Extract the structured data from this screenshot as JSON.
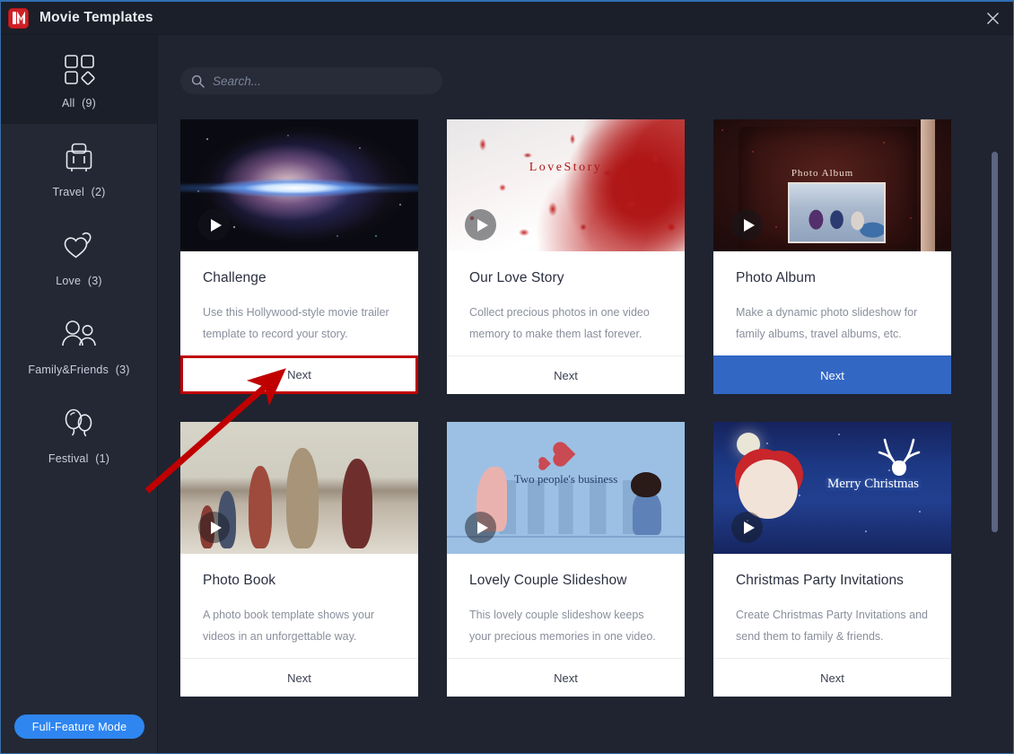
{
  "window": {
    "title": "Movie Templates",
    "close_icon": "close-icon",
    "app_icon": "app-logo-icon"
  },
  "sidebar": {
    "items": [
      {
        "label": "All",
        "count": "(9)",
        "icon": "grid-icon",
        "active": true
      },
      {
        "label": "Travel",
        "count": "(2)",
        "icon": "suitcase-icon",
        "active": false
      },
      {
        "label": "Love",
        "count": "(3)",
        "icon": "hearts-icon",
        "active": false
      },
      {
        "label": "Family&Friends",
        "count": "(3)",
        "icon": "people-icon",
        "active": false
      },
      {
        "label": "Festival",
        "count": "(1)",
        "icon": "balloons-icon",
        "active": false
      }
    ],
    "full_feature_button": "Full-Feature Mode"
  },
  "search": {
    "placeholder": "Search...",
    "value": "",
    "icon": "search-icon"
  },
  "templates": [
    {
      "title": "Challenge",
      "description": "Use this Hollywood-style movie trailer template to record your story.",
      "next_label": "Next",
      "thumb": "galaxy",
      "thumb_text": "",
      "next_state": "highlighted",
      "play_icon": "play-icon"
    },
    {
      "title": "Our Love Story",
      "description": "Collect precious photos in one video memory to make them last forever.",
      "next_label": "Next",
      "thumb": "love",
      "thumb_text": "LoveStory",
      "next_state": "default",
      "play_icon": "play-icon"
    },
    {
      "title": "Photo Album",
      "description": "Make a dynamic photo slideshow for family albums, travel albums, etc.",
      "next_label": "Next",
      "thumb": "album",
      "thumb_text": "Photo Album",
      "next_state": "hover",
      "play_icon": "play-icon"
    },
    {
      "title": "Photo Book",
      "description": "A photo book template shows your videos in an unforgettable way.",
      "next_label": "Next",
      "thumb": "beach",
      "thumb_text": "",
      "next_state": "default",
      "play_icon": "play-icon"
    },
    {
      "title": "Lovely Couple Slideshow",
      "description": "This lovely couple slideshow keeps your precious memories in one video.",
      "next_label": "Next",
      "thumb": "couple",
      "thumb_text": "Two people's business",
      "next_state": "default",
      "play_icon": "play-icon"
    },
    {
      "title": "Christmas Party Invitations",
      "description": "Create Christmas Party Invitations and send them to family & friends.",
      "next_label": "Next",
      "thumb": "xmas",
      "thumb_text": "Merry Christmas",
      "next_state": "default",
      "play_icon": "play-icon"
    }
  ],
  "colors": {
    "accent_blue": "#2f86f0",
    "hover_button": "#3267c4",
    "annotation_red": "#c00000",
    "window_bg": "#1f2430",
    "sidebar_bg": "#232834",
    "titlebar_bg": "#1b1f29"
  },
  "annotation": {
    "type": "arrow",
    "points_to": "challenge-next-button"
  }
}
